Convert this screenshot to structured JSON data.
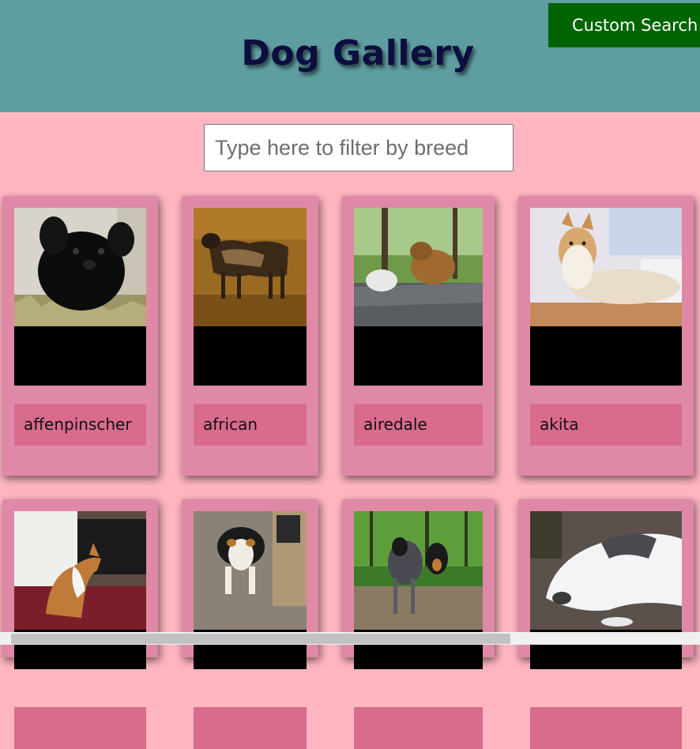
{
  "header": {
    "title": "Dog Gallery",
    "custom_search_label": "Custom Search"
  },
  "filter": {
    "placeholder": "Type here to filter by breed",
    "value": ""
  },
  "cards": [
    {
      "breed": "affenpinscher"
    },
    {
      "breed": "african"
    },
    {
      "breed": "airedale"
    },
    {
      "breed": "akita"
    },
    {
      "breed": ""
    },
    {
      "breed": ""
    },
    {
      "breed": ""
    },
    {
      "breed": ""
    }
  ],
  "colors": {
    "header_bg": "#5f9ea0",
    "page_bg": "#ffb6c1",
    "card_bg": "#e089a6",
    "label_bg": "#d96b8d",
    "custom_search_bg": "#006400",
    "title_color": "#0d0d40"
  }
}
